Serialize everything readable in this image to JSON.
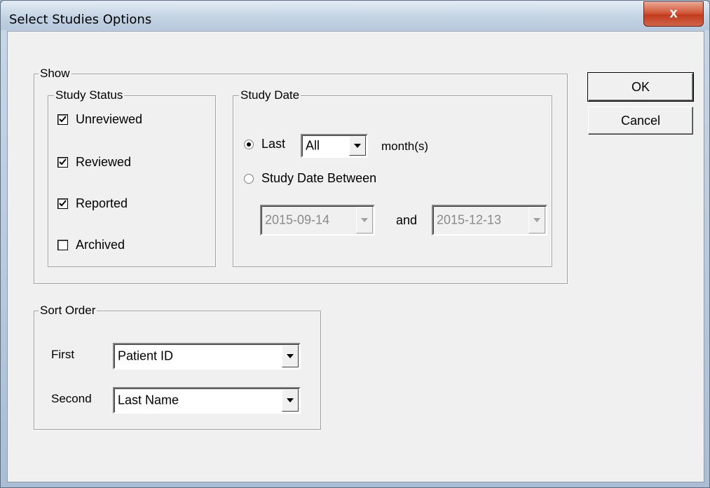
{
  "window": {
    "title": "Select Studies Options",
    "close_glyph": "x"
  },
  "show_group": {
    "label": "Show"
  },
  "study_status": {
    "label": "Study Status",
    "items": [
      {
        "label": "Unreviewed",
        "checked": true
      },
      {
        "label": "Reviewed",
        "checked": true
      },
      {
        "label": "Reported",
        "checked": true
      },
      {
        "label": "Archived",
        "checked": false
      }
    ]
  },
  "study_date": {
    "label": "Study Date",
    "last_label": "Last",
    "last_value": "All",
    "months_label": "month(s)",
    "between_label": "Study Date Between",
    "selected": "last",
    "from_date": "2015-09-14",
    "and_label": "and",
    "to_date": "2015-12-13"
  },
  "sort_order": {
    "label": "Sort Order",
    "first_label": "First",
    "first_value": "Patient ID",
    "second_label": "Second",
    "second_value": "Last Name"
  },
  "buttons": {
    "ok": "OK",
    "cancel": "Cancel"
  }
}
